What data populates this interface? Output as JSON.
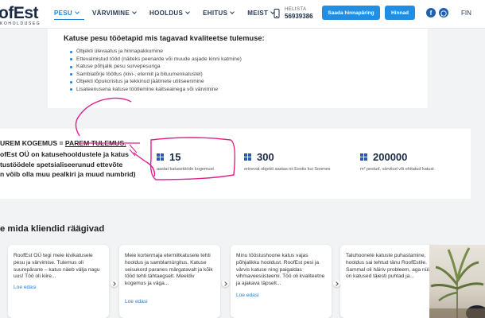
{
  "header": {
    "logo_text": "ofEst",
    "logo_sub": "KOHOLDUSEG",
    "nav": [
      {
        "label": "PESU",
        "active": true,
        "has_dropdown": true
      },
      {
        "label": "VÄRVIMINE",
        "active": false,
        "has_dropdown": true
      },
      {
        "label": "HOOLDUS",
        "active": false,
        "has_dropdown": true
      },
      {
        "label": "EHITUS",
        "active": false,
        "has_dropdown": true
      },
      {
        "label": "MEIST",
        "active": false,
        "has_dropdown": true
      }
    ],
    "phone_label": "HELISTA",
    "phone_number": "56939386",
    "offer_button": "Saada hinnapäring",
    "price_button": "Hinnad",
    "social": {
      "facebook_icon": "facebook-icon",
      "whatsapp_icon": "whatsapp-icon"
    },
    "language": "FIN"
  },
  "services": {
    "title": "Katuse pesu tööetapid mis tagavad kvaliteetse tulemuse:",
    "items": [
      "Objekti ülevaatus ja hinnapakkumine",
      "Ettevalmistud tööd (näiteks peenarde või muude asjade kinni katmine)",
      "Katuse põhjalik pesu survepesuriga",
      "Samblatõrje töötlus (kivi-, eterniit ja bituumenkatustel)",
      "Objekti lõpukoristus ja tekkinud jäätmete utiliseerimine",
      "Lisateenusena katuse töötlemine kaitseainega või värvimine"
    ]
  },
  "intro": {
    "line1_prefix": "UREM KOGEMUS",
    "line1_eq": " = ",
    "line1_suffix": "PAREM TULEMUS.",
    "line2": "ofEst OÜ on katusehooldustele ja katus",
    "line3": "tustöödele spetsialiseerunud ettevõte",
    "line4": "n võib olla muu pealkiri ja muud numbrid)"
  },
  "stats": [
    {
      "number": "15",
      "caption": "aastat katusetööde kogemust"
    },
    {
      "number": "300",
      "caption": "erinevat objekti aastas nii Eestis kui Soomes"
    },
    {
      "number": "200000",
      "caption": "m² pestud, värvitud või ehitatud katust"
    }
  ],
  "reviews": {
    "title": "e mida kliendid räägivad",
    "read_more": "Loe edasi",
    "cards": [
      {
        "text": "RoofEst OÜ tegi meie kivikatusele pesu ja värvimise. Tulemus oli suurepärane – katus näeb välja nagu uus! Töö oli kiire..."
      },
      {
        "text": "Meie kortermaja eterniitkatusele tehti hooldus ja samblamürgitus. Katuse seisukord paranes märgatavalt ja kõik tööd tehti tähtaegselt. Meeldiv kogemus ja väga..."
      },
      {
        "text": "Minu tööstushoone katus vajas põhjalikku hooldust. RoofEst pesi ja värvis katuse ning paigaldas vihmaveesüsteemi. Töö oli kvaliteetne ja ajakava täpselt..."
      },
      {
        "text": "Taluhoonete katuste puhastamine, hooldus sai tehtud tänu RoofEstile. Sammal oli häiriv probleem, aga nüüd on katused täiesti puhtad ja..."
      }
    ]
  },
  "colors": {
    "accent": "#1f8fe5",
    "nav_active": "#1f7fd8",
    "dark": "#1a2a44",
    "annotation": "#e0208a"
  }
}
